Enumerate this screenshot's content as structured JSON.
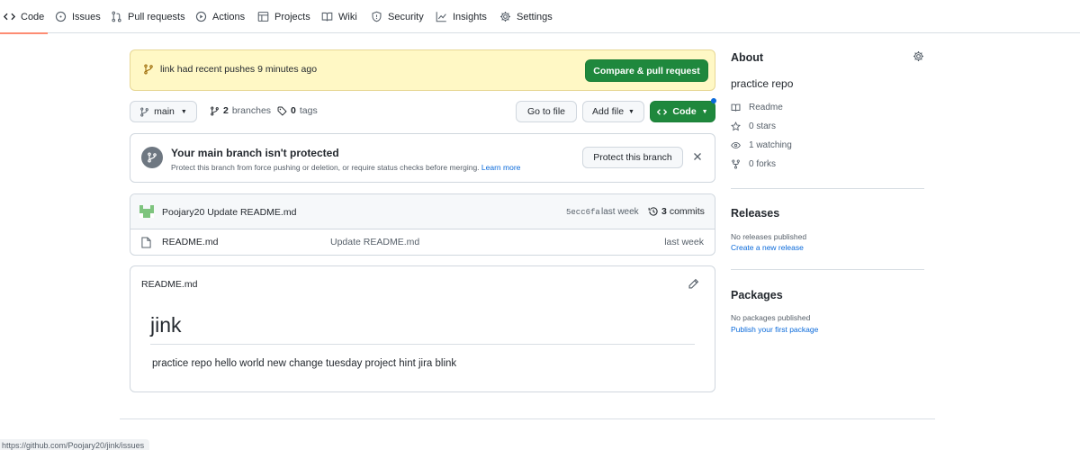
{
  "tabs": [
    {
      "label": "Code",
      "icon": "code-icon"
    },
    {
      "label": "Issues",
      "icon": "issue-icon"
    },
    {
      "label": "Pull requests",
      "icon": "pull-request-icon"
    },
    {
      "label": "Actions",
      "icon": "play-icon"
    },
    {
      "label": "Projects",
      "icon": "table-icon"
    },
    {
      "label": "Wiki",
      "icon": "book-icon"
    },
    {
      "label": "Security",
      "icon": "shield-icon"
    },
    {
      "label": "Insights",
      "icon": "graph-icon"
    },
    {
      "label": "Settings",
      "icon": "gear-icon"
    }
  ],
  "banner": {
    "branch": "link",
    "text": "had recent pushes 9 minutes ago",
    "button": "Compare & pull request"
  },
  "branch_bar": {
    "branch": "main",
    "branches_count": "2",
    "branches_label": "branches",
    "tags_count": "0",
    "tags_label": "tags",
    "go_to_file": "Go to file",
    "add_file": "Add file",
    "code": "Code"
  },
  "protect": {
    "title": "Your main branch isn't protected",
    "description": "Protect this branch from force pushing or deletion, or require status checks before merging.",
    "learn_more": "Learn more",
    "button": "Protect this branch"
  },
  "latest_commit": {
    "author": "Poojary20",
    "message": "Update README.md",
    "sha": "5ecc6fa",
    "when": "last week",
    "commits_count": "3",
    "commits_label": "commits"
  },
  "files": [
    {
      "name": "README.md",
      "message": "Update README.md",
      "when": "last week"
    }
  ],
  "readme": {
    "filename": "README.md",
    "heading": "jink",
    "body": "practice repo hello world new change tuesday project hint jira blink"
  },
  "sidebar": {
    "about_title": "About",
    "description": "practice repo",
    "readme": "Readme",
    "stars": "0 stars",
    "watching": "1 watching",
    "forks": "0 forks",
    "releases_title": "Releases",
    "releases_none": "No releases published",
    "releases_link": "Create a new release",
    "packages_title": "Packages",
    "packages_none": "No packages published",
    "packages_link": "Publish your first package"
  },
  "status_bar_url": "https://github.com/Poojary20/jink/issues",
  "colors": {
    "accent_green": "#1f883d",
    "link_blue": "#0969da",
    "banner_yellow": "#fff8c5",
    "active_tab_underline": "#fd8c73"
  }
}
